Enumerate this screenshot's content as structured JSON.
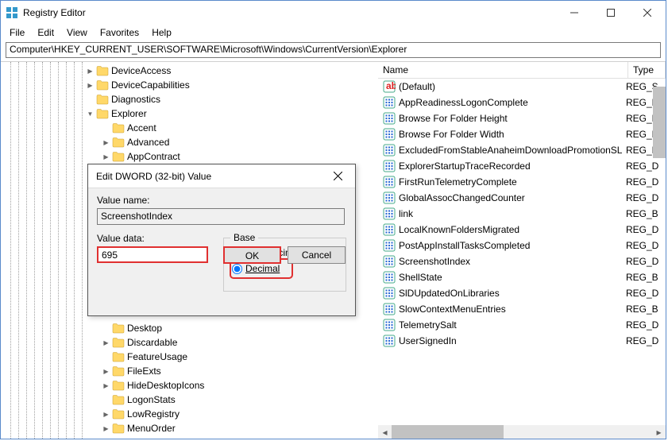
{
  "window": {
    "title": "Registry Editor"
  },
  "menu": {
    "file": "File",
    "edit": "Edit",
    "view": "View",
    "favorites": "Favorites",
    "help": "Help"
  },
  "address": "Computer\\HKEY_CURRENT_USER\\SOFTWARE\\Microsoft\\Windows\\CurrentVersion\\Explorer",
  "tree": {
    "items": [
      {
        "indent": 105,
        "exp": ">",
        "label": "DeviceAccess"
      },
      {
        "indent": 105,
        "exp": ">",
        "label": "DeviceCapabilities"
      },
      {
        "indent": 105,
        "exp": "",
        "label": "Diagnostics"
      },
      {
        "indent": 105,
        "exp": "v",
        "label": "Explorer"
      },
      {
        "indent": 125,
        "exp": "",
        "label": "Accent"
      },
      {
        "indent": 125,
        "exp": ">",
        "label": "Advanced"
      },
      {
        "indent": 125,
        "exp": ">",
        "label": "AppContract"
      },
      {
        "indent": 125,
        "exp": "",
        "label": "Desktop"
      },
      {
        "indent": 125,
        "exp": ">",
        "label": "Discardable"
      },
      {
        "indent": 125,
        "exp": "",
        "label": "FeatureUsage"
      },
      {
        "indent": 125,
        "exp": ">",
        "label": "FileExts"
      },
      {
        "indent": 125,
        "exp": ">",
        "label": "HideDesktopIcons"
      },
      {
        "indent": 125,
        "exp": "",
        "label": "LogonStats"
      },
      {
        "indent": 125,
        "exp": ">",
        "label": "LowRegistry"
      },
      {
        "indent": 125,
        "exp": ">",
        "label": "MenuOrder"
      }
    ]
  },
  "list": {
    "headers": {
      "name": "Name",
      "type": "Type"
    },
    "items": [
      {
        "icon": "sz",
        "name": "(Default)",
        "type": "REG_S"
      },
      {
        "icon": "bin",
        "name": "AppReadinessLogonComplete",
        "type": "REG_D"
      },
      {
        "icon": "bin",
        "name": "Browse For Folder Height",
        "type": "REG_D"
      },
      {
        "icon": "bin",
        "name": "Browse For Folder Width",
        "type": "REG_D"
      },
      {
        "icon": "bin",
        "name": "ExcludedFromStableAnaheimDownloadPromotionSL",
        "type": "REG_D"
      },
      {
        "icon": "bin",
        "name": "ExplorerStartupTraceRecorded",
        "type": "REG_D"
      },
      {
        "icon": "bin",
        "name": "FirstRunTelemetryComplete",
        "type": "REG_D"
      },
      {
        "icon": "bin",
        "name": "GlobalAssocChangedCounter",
        "type": "REG_D"
      },
      {
        "icon": "bin",
        "name": "link",
        "type": "REG_B"
      },
      {
        "icon": "bin",
        "name": "LocalKnownFoldersMigrated",
        "type": "REG_D"
      },
      {
        "icon": "bin",
        "name": "PostAppInstallTasksCompleted",
        "type": "REG_D"
      },
      {
        "icon": "bin",
        "name": "ScreenshotIndex",
        "type": "REG_D",
        "sel": true
      },
      {
        "icon": "bin",
        "name": "ShellState",
        "type": "REG_B"
      },
      {
        "icon": "bin",
        "name": "SlDUpdatedOnLibraries",
        "type": "REG_D"
      },
      {
        "icon": "bin",
        "name": "SlowContextMenuEntries",
        "type": "REG_B"
      },
      {
        "icon": "bin",
        "name": "TelemetrySalt",
        "type": "REG_D"
      },
      {
        "icon": "bin",
        "name": "UserSignedIn",
        "type": "REG_D"
      }
    ]
  },
  "dialog": {
    "title": "Edit DWORD (32-bit) Value",
    "value_name_label": "Value name:",
    "value_name": "ScreenshotIndex",
    "value_data_label": "Value data:",
    "value_data": "695",
    "base_label": "Base",
    "hex": "Hexadecimal",
    "dec": "Decimal",
    "ok": "OK",
    "cancel": "Cancel"
  }
}
